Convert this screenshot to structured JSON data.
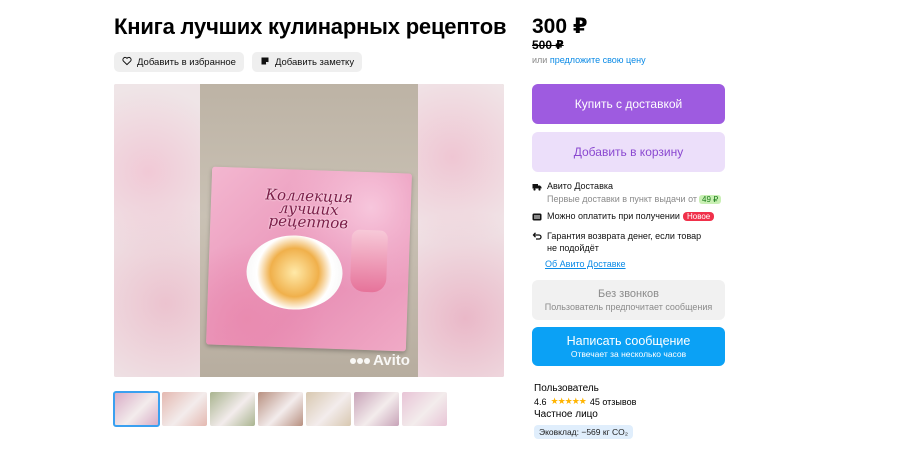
{
  "listing": {
    "title": "Книга лучших кулинарных рецептов",
    "actions": {
      "favorite_label": "Добавить в избранное",
      "note_label": "Добавить заметку"
    }
  },
  "gallery": {
    "watermark": "Avito",
    "book_cover_text": "Коллекция лучших рецептов",
    "thumbnail_colors": [
      "#d7a9c4",
      "#e4b8b0",
      "#a9b48f",
      "#b89080",
      "#d8c8b0",
      "#c8a3b8",
      "#e8c4d6"
    ],
    "selected_thumbnail_index": 0
  },
  "pricing": {
    "price": "300 ₽",
    "old_price": "500 ₽",
    "offer_prefix": "или",
    "offer_link": "предложите свою цену"
  },
  "buttons": {
    "buy": "Купить с доставкой",
    "cart": "Добавить в корзину"
  },
  "features": {
    "delivery_title": "Авито Доставка",
    "delivery_sub": "Первые доставки в пункт выдачи от",
    "delivery_price": "49 ₽",
    "pay_on_receive": "Можно оплатить при получении",
    "new_badge": "Новое",
    "guarantee_line1": "Гарантия возврата денег, если товар",
    "guarantee_line2": "не подойдёт",
    "about_link": "Об Авито Доставке"
  },
  "contact": {
    "no_calls_title": "Без звонков",
    "no_calls_sub": "Пользователь предпочитает сообщения",
    "message_title": "Написать сообщение",
    "message_sub": "Отвечает за несколько часов"
  },
  "seller": {
    "name": "Пользователь",
    "rating": "4.6",
    "stars": "★★★★★",
    "reviews": "45 отзывов",
    "type": "Частное лицо",
    "eco": "Эковклад: −569 кг CO₂"
  },
  "colors": {
    "buy_button": "#9e5be0",
    "cart_button": "#ecdffa",
    "message_button": "#0ba1f5",
    "link": "#0a8ae6"
  }
}
